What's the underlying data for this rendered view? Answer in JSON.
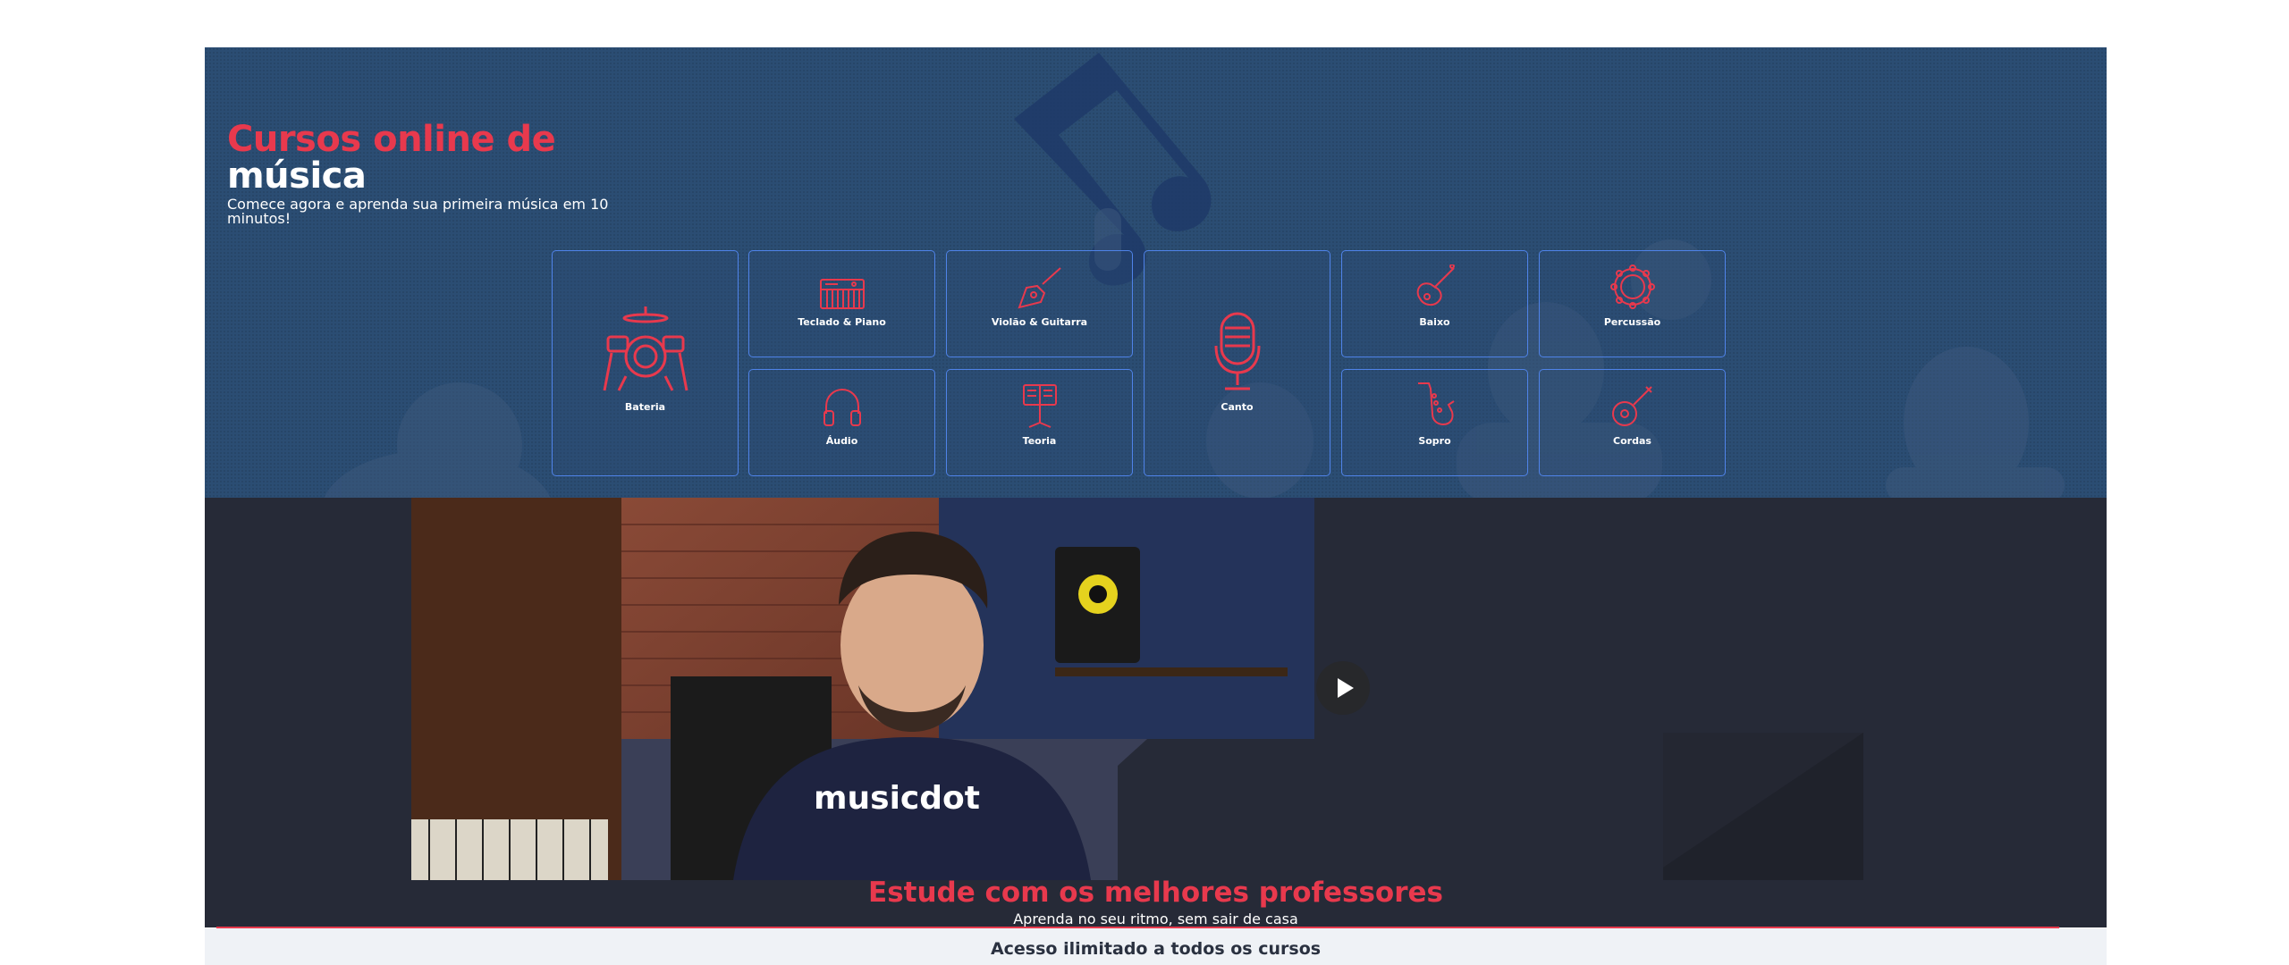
{
  "hero": {
    "title_line1": "Cursos online de",
    "title_line2": "música",
    "subtitle": "Comece agora e aprenda sua primeira música em 10 minutos!"
  },
  "categories": [
    {
      "label": "Bateria",
      "icon": "drum-kit-icon"
    },
    {
      "label": "Teclado & Piano",
      "icon": "keyboard-icon"
    },
    {
      "label": "Violão & Guitarra",
      "icon": "electric-guitar-icon"
    },
    {
      "label": "Canto",
      "icon": "microphone-icon"
    },
    {
      "label": "Baixo",
      "icon": "bass-guitar-icon"
    },
    {
      "label": "Percussão",
      "icon": "tambourine-icon"
    },
    {
      "label": "Áudio",
      "icon": "headphones-icon"
    },
    {
      "label": "Teoria",
      "icon": "music-stand-icon"
    },
    {
      "label": "Sopro",
      "icon": "saxophone-icon"
    },
    {
      "label": "Cordas",
      "icon": "ukulele-icon"
    }
  ],
  "video": {
    "shirt_brand": "musicdot",
    "play_icon": "play-icon"
  },
  "section": {
    "title": "Estude com os melhores professores",
    "subtitle": "Aprenda no seu ritmo, sem sair de casa"
  },
  "access": {
    "text": "Acesso ilimitado a todos os cursos"
  },
  "colors": {
    "accent_red": "#e8394d",
    "hero_blue": "#2b4d73",
    "card_border": "#4f83e8",
    "dark_section": "#262a37",
    "strip_bg": "#eff2f6"
  }
}
